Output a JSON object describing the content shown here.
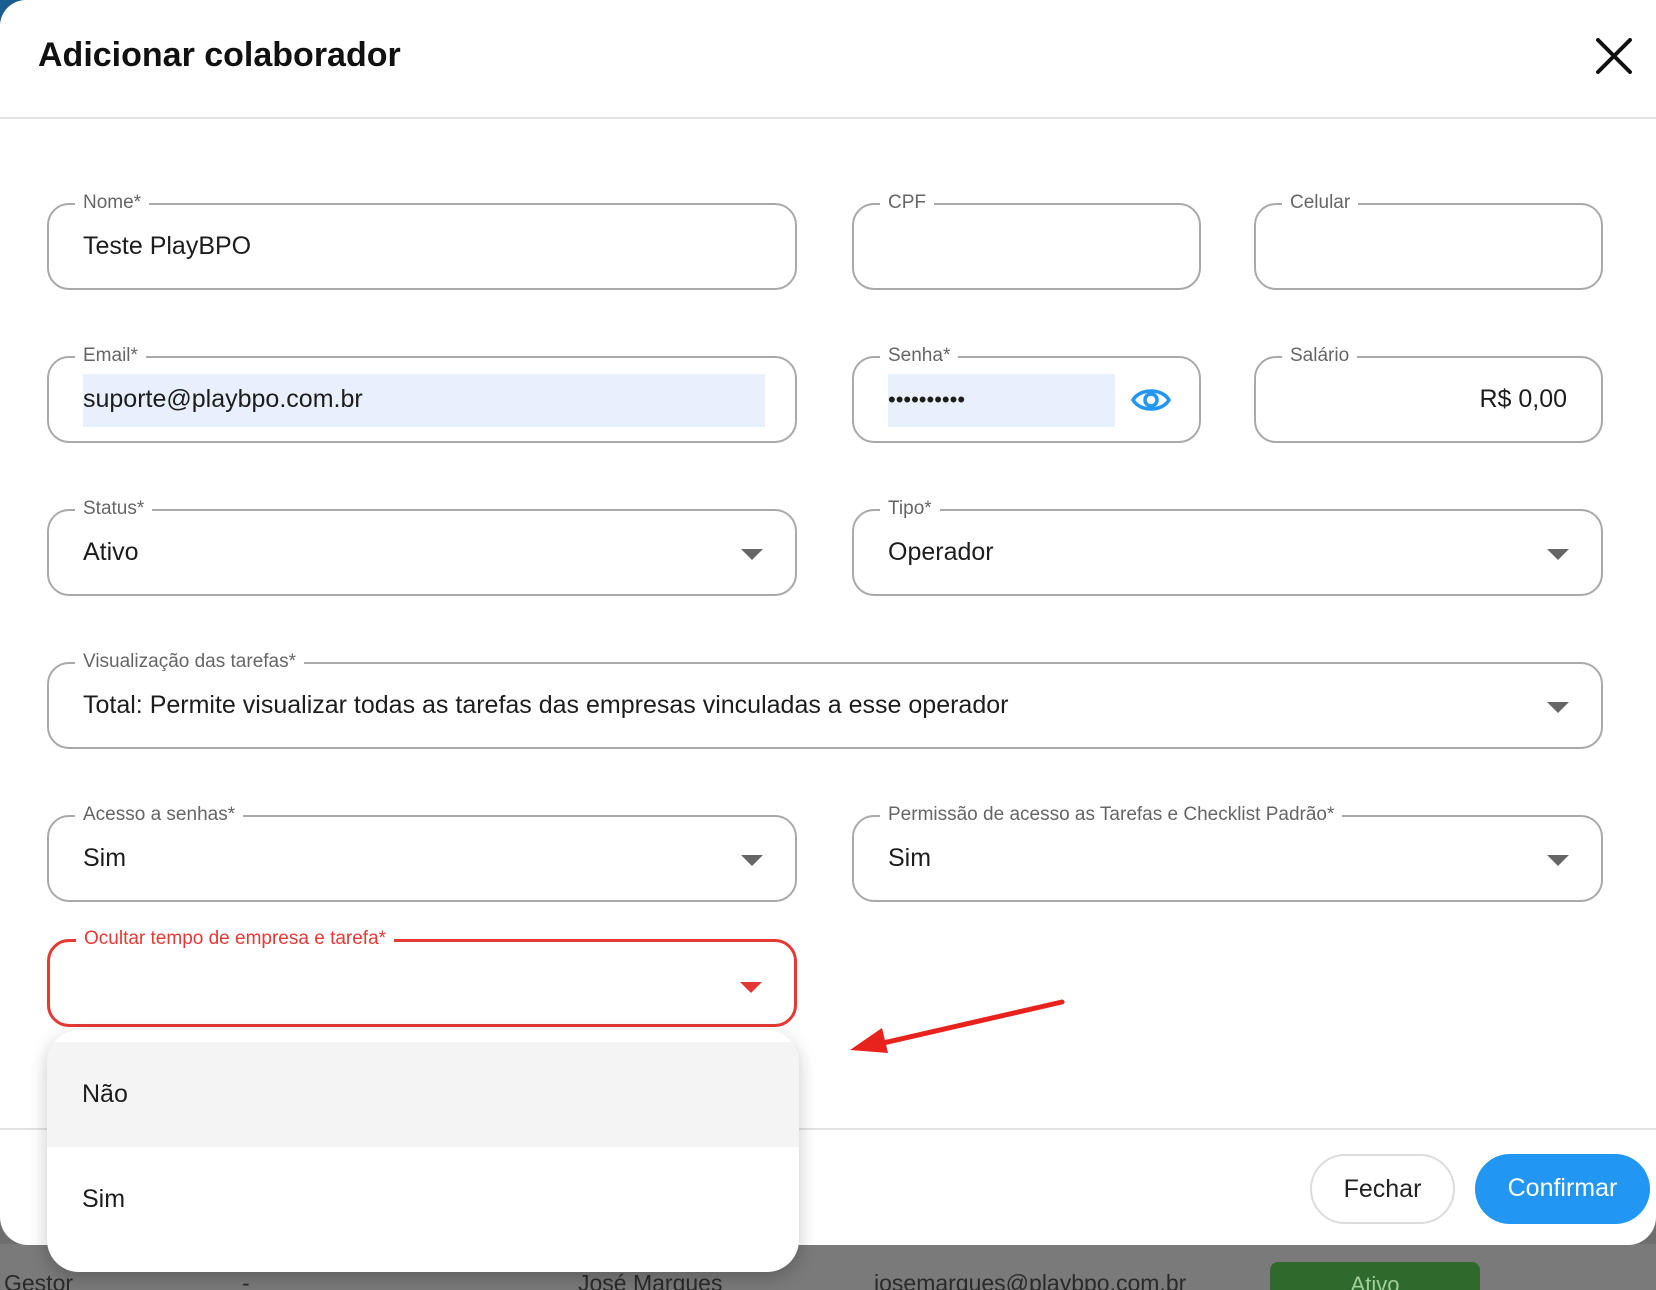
{
  "modal": {
    "title": "Adicionar colaborador",
    "close_icon": "close-icon"
  },
  "form": {
    "nome": {
      "label": "Nome*",
      "value": "Teste PlayBPO"
    },
    "cpf": {
      "label": "CPF",
      "value": ""
    },
    "celular": {
      "label": "Celular",
      "value": ""
    },
    "email": {
      "label": "Email*",
      "value": "suporte@playbpo.com.br"
    },
    "senha": {
      "label": "Senha*",
      "value": "••••••••••",
      "icon": "eye-icon"
    },
    "salario": {
      "label": "Salário",
      "value": "R$ 0,00"
    },
    "status": {
      "label": "Status*",
      "value": "Ativo"
    },
    "tipo": {
      "label": "Tipo*",
      "value": "Operador"
    },
    "visualizacao": {
      "label": "Visualização das tarefas*",
      "value": "Total: Permite visualizar todas as tarefas das empresas vinculadas a esse operador"
    },
    "acesso_senhas": {
      "label": "Acesso a senhas*",
      "value": "Sim"
    },
    "permissao": {
      "label": "Permissão de acesso as Tarefas e Checklist Padrão*",
      "value": "Sim"
    },
    "ocultar": {
      "label": "Ocultar tempo de empresa e tarefa*",
      "value": ""
    }
  },
  "dropdown": {
    "options": [
      "Não",
      "Sim"
    ]
  },
  "footer": {
    "close_label": "Fechar",
    "confirm_label": "Confirmar"
  },
  "background_row": {
    "col1": "Gestor",
    "col2": "-",
    "col3": "José Marques",
    "col4": "josemarques@playbpo.com.br",
    "status": "Ativo"
  },
  "colors": {
    "primary": "#2196f3",
    "error": "#e53935",
    "annotation_arrow": "#e8231e"
  }
}
